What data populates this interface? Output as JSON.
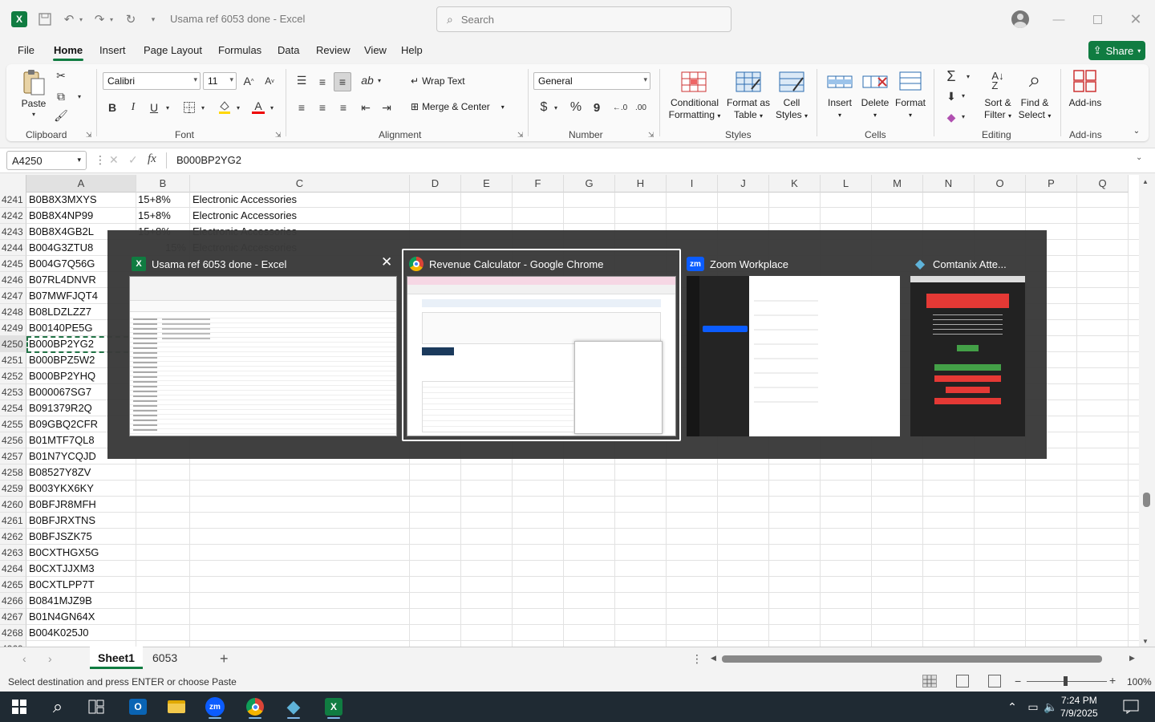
{
  "window": {
    "title": "Usama ref 6053 done - Excel",
    "search_placeholder": "Search"
  },
  "menu": [
    "File",
    "Home",
    "Insert",
    "Page Layout",
    "Formulas",
    "Data",
    "Review",
    "View",
    "Help"
  ],
  "share_label": "Share",
  "ribbon": {
    "clipboard": {
      "paste": "Paste",
      "label": "Clipboard"
    },
    "font": {
      "name": "Calibri",
      "size": "11",
      "label": "Font",
      "bold": "B",
      "italic": "I",
      "underline": "U"
    },
    "alignment": {
      "wrap": "Wrap Text",
      "merge": "Merge & Center",
      "label": "Alignment"
    },
    "number": {
      "format": "General",
      "label": "Number",
      "currency": "$",
      "percent": "%",
      "comma": "9"
    },
    "styles": {
      "conditional": [
        "Conditional",
        "Formatting"
      ],
      "format_table": [
        "Format as",
        "Table"
      ],
      "cell_styles": [
        "Cell",
        "Styles"
      ],
      "label": "Styles"
    },
    "cells": {
      "insert": "Insert",
      "delete": "Delete",
      "format": "Format",
      "label": "Cells"
    },
    "editing": {
      "sort": [
        "Sort &",
        "Filter"
      ],
      "find": [
        "Find &",
        "Select"
      ],
      "label": "Editing"
    },
    "addins": {
      "btn": "Add-ins",
      "label": "Add-ins"
    }
  },
  "formula_bar": {
    "name_box": "A4250",
    "fx": "fx",
    "content": "B000BP2YG2"
  },
  "columns": [
    "A",
    "B",
    "C",
    "D",
    "E",
    "F",
    "G",
    "H",
    "I",
    "J",
    "K",
    "L",
    "M",
    "N",
    "O",
    "P",
    "Q"
  ],
  "rows": [
    {
      "n": "4241",
      "a": "B0B8X3MXYS",
      "b": "15+8%",
      "c": "Electronic Accessories"
    },
    {
      "n": "4242",
      "a": "B0B8X4NP99",
      "b": "15+8%",
      "c": "Electronic Accessories"
    },
    {
      "n": "4243",
      "a": "B0B8X4GB2L",
      "b": "15+8%",
      "c": "Electronic Accessories"
    },
    {
      "n": "4244",
      "a": "B004G3ZTU8",
      "b": "15%",
      "c": "Electronic Accessories"
    },
    {
      "n": "4245",
      "a": "B004G7Q56G",
      "b": "",
      "c": ""
    },
    {
      "n": "4246",
      "a": "B07RL4DNVR",
      "b": "",
      "c": ""
    },
    {
      "n": "4247",
      "a": "B07MWFJQT4",
      "b": "",
      "c": ""
    },
    {
      "n": "4248",
      "a": "B08LDZLZZ7",
      "b": "",
      "c": ""
    },
    {
      "n": "4249",
      "a": "B00140PE5G",
      "b": "",
      "c": ""
    },
    {
      "n": "4250",
      "a": "B000BP2YG2",
      "b": "",
      "c": ""
    },
    {
      "n": "4251",
      "a": "B000BPZ5W2",
      "b": "",
      "c": ""
    },
    {
      "n": "4252",
      "a": "B000BP2YHQ",
      "b": "",
      "c": ""
    },
    {
      "n": "4253",
      "a": "B000067SG7",
      "b": "",
      "c": ""
    },
    {
      "n": "4254",
      "a": "B091379R2Q",
      "b": "",
      "c": ""
    },
    {
      "n": "4255",
      "a": "B09GBQ2CFR",
      "b": "",
      "c": ""
    },
    {
      "n": "4256",
      "a": "B01MTF7QL8",
      "b": "",
      "c": ""
    },
    {
      "n": "4257",
      "a": "B01N7YCQJD",
      "b": "",
      "c": ""
    },
    {
      "n": "4258",
      "a": "B08527Y8ZV",
      "b": "",
      "c": ""
    },
    {
      "n": "4259",
      "a": "B003YKX6KY",
      "b": "",
      "c": ""
    },
    {
      "n": "4260",
      "a": "B0BFJR8MFH",
      "b": "",
      "c": ""
    },
    {
      "n": "4261",
      "a": "B0BFJRXTNS",
      "b": "",
      "c": ""
    },
    {
      "n": "4262",
      "a": "B0BFJSZK75",
      "b": "",
      "c": ""
    },
    {
      "n": "4263",
      "a": "B0CXTHGX5G",
      "b": "",
      "c": ""
    },
    {
      "n": "4264",
      "a": "B0CXTJJXM3",
      "b": "",
      "c": ""
    },
    {
      "n": "4265",
      "a": "B0CXTLPP7T",
      "b": "",
      "c": ""
    },
    {
      "n": "4266",
      "a": "B0841MJZ9B",
      "b": "",
      "c": ""
    },
    {
      "n": "4267",
      "a": "B01N4GN64X",
      "b": "",
      "c": ""
    },
    {
      "n": "4268",
      "a": "B004K025J0",
      "b": "",
      "c": ""
    },
    {
      "n": "4269",
      "a": "",
      "b": "",
      "c": ""
    }
  ],
  "sheets": [
    "Sheet1",
    "6053"
  ],
  "status": {
    "message": "Select destination and press ENTER or choose Paste",
    "zoom": "100%"
  },
  "switcher": {
    "windows": [
      {
        "title": "Usama ref 6053 done - Excel",
        "app": "excel"
      },
      {
        "title": "Revenue Calculator - Google Chrome",
        "app": "chrome"
      },
      {
        "title": "Zoom Workplace",
        "app": "zoom"
      },
      {
        "title": "Comtanix Atte...",
        "app": "comtanix"
      }
    ]
  },
  "taskbar": {
    "time": "7:24 PM",
    "date": "7/9/2025",
    "zoom_label": "zm"
  },
  "colors": {
    "excel_green": "#107c41",
    "taskbar": "#1f2a33",
    "switcher_bg": "#3a3a3a"
  }
}
